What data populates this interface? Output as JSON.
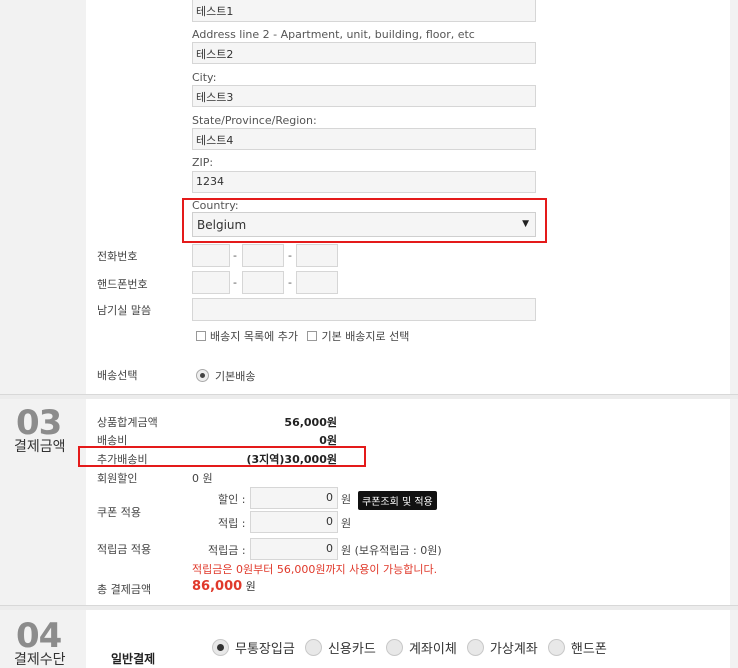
{
  "address": {
    "line1_value": "테스트1",
    "line2_label": "Address line 2 - Apartment, unit, building, floor, etc",
    "line2_value": "테스트2",
    "city_label": "City:",
    "city_value": "테스트3",
    "state_label": "State/Province/Region:",
    "state_value": "테스트4",
    "zip_label": "ZIP:",
    "zip_value": "1234",
    "country_label": "Country:",
    "country_value": "Belgium"
  },
  "contact": {
    "phone_label": "전화번호",
    "mobile_label": "핸드폰번호",
    "message_label": "남기실 말씀",
    "dash": "-",
    "add_to_list_label": "배송지 목록에 추가",
    "set_default_label": "기본 배송지로 선택"
  },
  "shipping": {
    "select_label": "배송선택",
    "option_label": "기본배송"
  },
  "section3": {
    "number": "03",
    "title": "결제금액",
    "subtotal_label": "상품합계금액",
    "subtotal_value": "56,000원",
    "shipping_label": "배송비",
    "shipping_value": "0원",
    "extra_shipping_label": "추가배송비",
    "extra_shipping_value": "(3지역)30,000원",
    "member_discount_label": "회원할인",
    "member_discount_value": "0 원",
    "coupon_label": "쿠폰 적용",
    "coupon_discount_label": "할인 :",
    "coupon_discount_value": "0",
    "coupon_discount_unit": "원",
    "coupon_button": "쿠폰조회 및 적용",
    "coupon_reserve_label": "적립 :",
    "coupon_reserve_value": "0",
    "coupon_reserve_unit": "원",
    "points_label": "적립금 적용",
    "points_field_label": "적립금 :",
    "points_value": "0",
    "points_unit": "원 (보유적립금 : 0원)",
    "points_notice": "적립금은 0원부터 56,000원까지 사용이 가능합니다.",
    "total_label": "총 결제금액",
    "total_value": "86,000",
    "total_unit": "원"
  },
  "section4": {
    "number": "04",
    "title": "결제수단",
    "general_label": "일반결제",
    "options": [
      "무통장입금",
      "신용카드",
      "계좌이체",
      "가상계좌",
      "핸드폰"
    ]
  },
  "colors": {
    "highlight_red": "#e41a1a",
    "notice_red": "#e0392b",
    "total_red": "#e0392b"
  }
}
